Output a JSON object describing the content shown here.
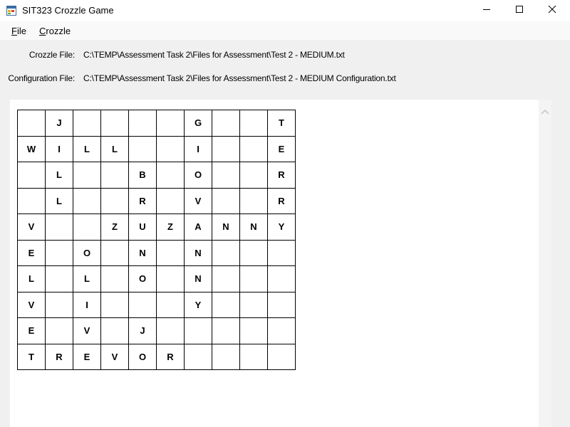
{
  "window": {
    "title": "SIT323 Crozzle Game"
  },
  "menu": {
    "file": {
      "accel": "F",
      "rest": "ile"
    },
    "crozzle": {
      "accel": "C",
      "rest": "rozzle"
    }
  },
  "info": {
    "crozzle_file_label": "Crozzle File:",
    "crozzle_file_value": "C:\\TEMP\\Assessment Task 2\\Files for Assessment\\Test 2 - MEDIUM.txt",
    "config_file_label": "Configuration File:",
    "config_file_value": "C:\\TEMP\\Assessment Task 2\\Files for Assessment\\Test 2 - MEDIUM Configuration.txt"
  },
  "icons": {
    "app": "app-window-icon",
    "minimize": "minimize-icon",
    "maximize": "maximize-icon",
    "close": "close-icon",
    "scroll_up": "chevron-up-icon"
  },
  "grid": {
    "rows": [
      [
        "",
        "J",
        "",
        "",
        "",
        "",
        "G",
        "",
        "",
        "T"
      ],
      [
        "W",
        "I",
        "L",
        "L",
        "",
        "",
        "I",
        "",
        "",
        "E"
      ],
      [
        "",
        "L",
        "",
        "",
        "B",
        "",
        "O",
        "",
        "",
        "R"
      ],
      [
        "",
        "L",
        "",
        "",
        "R",
        "",
        "V",
        "",
        "",
        "R"
      ],
      [
        "V",
        "",
        "",
        "Z",
        "U",
        "Z",
        "A",
        "N",
        "N",
        "Y"
      ],
      [
        "E",
        "",
        "O",
        "",
        "N",
        "",
        "N",
        "",
        "",
        ""
      ],
      [
        "L",
        "",
        "L",
        "",
        "O",
        "",
        "N",
        "",
        "",
        ""
      ],
      [
        "V",
        "",
        "I",
        "",
        "",
        "",
        "Y",
        "",
        "",
        ""
      ],
      [
        "E",
        "",
        "V",
        "",
        "J",
        "",
        "",
        "",
        "",
        ""
      ],
      [
        "T",
        "R",
        "E",
        "V",
        "O",
        "R",
        "",
        "",
        "",
        ""
      ]
    ]
  }
}
